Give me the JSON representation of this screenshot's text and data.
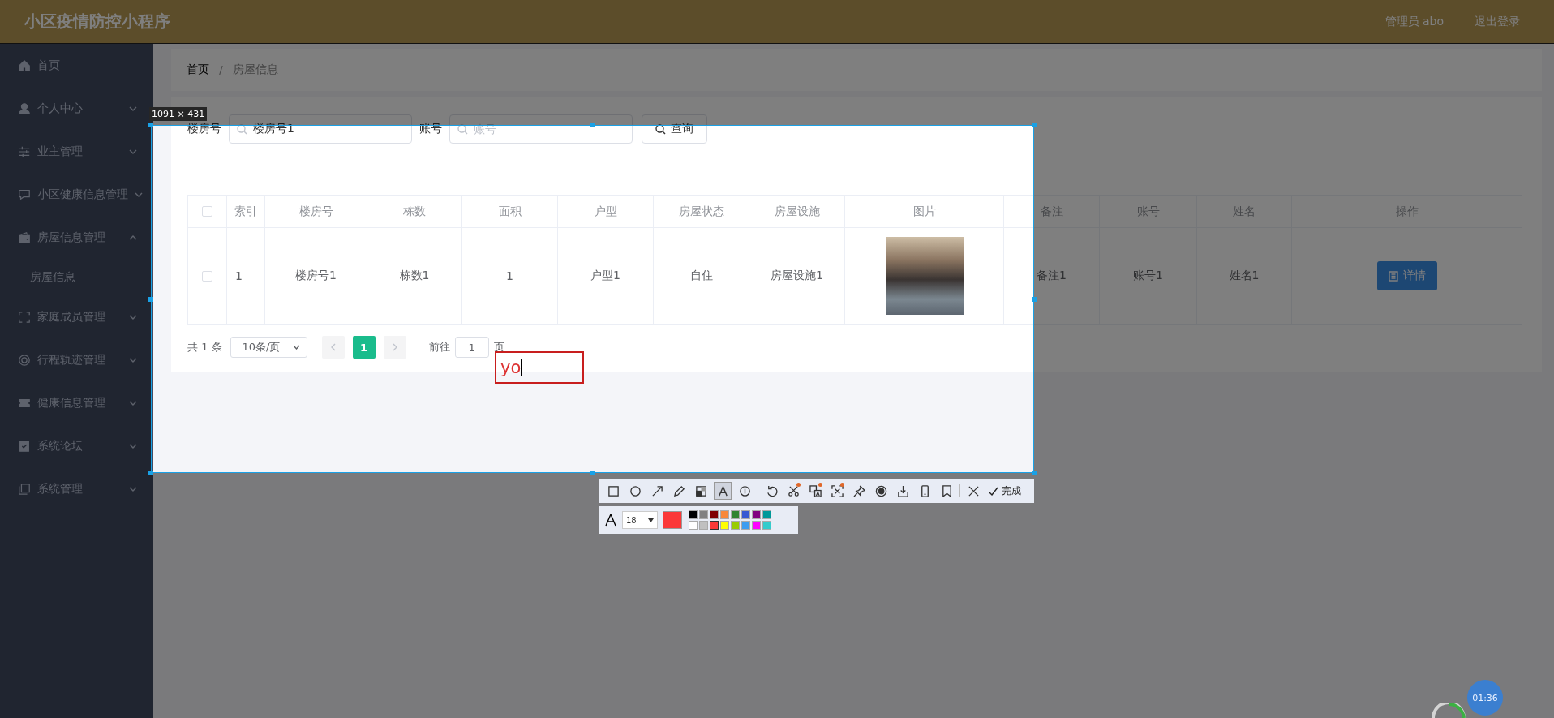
{
  "header": {
    "title": "小区疫情防控小程序",
    "user": "管理员 abo",
    "logout": "退出登录"
  },
  "sidebar": {
    "items": [
      {
        "kind": "link",
        "label": "首页"
      },
      {
        "kind": "menu",
        "label": "个人中心",
        "expanded": false
      },
      {
        "kind": "menu",
        "label": "业主管理",
        "expanded": false
      },
      {
        "kind": "menu",
        "label": "小区健康信息管理",
        "expanded": false
      },
      {
        "kind": "menu",
        "label": "房屋信息管理",
        "expanded": true,
        "children": [
          {
            "label": "房屋信息"
          }
        ]
      },
      {
        "kind": "menu",
        "label": "家庭成员管理",
        "expanded": false
      },
      {
        "kind": "menu",
        "label": "行程轨迹管理",
        "expanded": false
      },
      {
        "kind": "menu",
        "label": "健康信息管理",
        "expanded": false
      },
      {
        "kind": "menu",
        "label": "系统论坛",
        "expanded": false
      },
      {
        "kind": "menu",
        "label": "系统管理",
        "expanded": false
      }
    ]
  },
  "breadcrumb": {
    "items": [
      "首页",
      "房屋信息"
    ],
    "separator": "/"
  },
  "search": {
    "fields": [
      {
        "label": "楼房号",
        "value": "楼房号1"
      },
      {
        "label": "账号",
        "placeholder": "账号"
      }
    ],
    "button": "查询"
  },
  "table": {
    "all_checked": false,
    "columns": [
      {
        "label": "索引",
        "kind": "text"
      },
      {
        "label": "楼房号",
        "kind": "text"
      },
      {
        "label": "栋数",
        "kind": "text"
      },
      {
        "label": "面积",
        "kind": "text"
      },
      {
        "label": "户型",
        "kind": "text"
      },
      {
        "label": "房屋状态",
        "kind": "text"
      },
      {
        "label": "房屋设施",
        "kind": "text"
      },
      {
        "label": "图片",
        "kind": "image"
      },
      {
        "label": "备注",
        "kind": "text"
      },
      {
        "label": "账号",
        "kind": "text"
      },
      {
        "label": "姓名",
        "kind": "text"
      },
      {
        "label": "操作",
        "kind": "action"
      }
    ],
    "rows": [
      {
        "checked": false,
        "cells": [
          "1",
          "楼房号1",
          "栋数1",
          "1",
          "户型1",
          "自住",
          "房屋设施1",
          "",
          "备注1",
          "账号1",
          "姓名1",
          "详情"
        ]
      }
    ]
  },
  "pagination": {
    "total": "共 1 条",
    "page_size": "10条/页",
    "pages": [
      {
        "label": "1",
        "selected": true
      }
    ],
    "goto_label": "前往",
    "goto_value": "1",
    "goto_suffix": "页"
  },
  "capture_tool": {
    "size_label": "1091 × 431",
    "tools": [
      {
        "kind": "rectangle",
        "selected": false,
        "dot": false
      },
      {
        "kind": "circle",
        "selected": false,
        "dot": false
      },
      {
        "kind": "arrow",
        "selected": false,
        "dot": false
      },
      {
        "kind": "pencil",
        "selected": false,
        "dot": false
      },
      {
        "kind": "mosaic",
        "selected": false,
        "dot": false
      },
      {
        "kind": "text",
        "selected": true,
        "dot": false
      },
      {
        "kind": "number",
        "selected": false,
        "dot": false
      },
      {
        "kind": "undo",
        "selected": false,
        "dot": false
      },
      {
        "kind": "scissors",
        "selected": false,
        "dot": true
      },
      {
        "kind": "translate",
        "selected": false,
        "dot": true
      },
      {
        "kind": "recognize",
        "selected": false,
        "dot": true
      },
      {
        "kind": "pin",
        "selected": false,
        "dot": false
      },
      {
        "kind": "record",
        "selected": false,
        "dot": false
      },
      {
        "kind": "download",
        "selected": false,
        "dot": false
      },
      {
        "kind": "phone",
        "selected": false,
        "dot": false
      },
      {
        "kind": "bookmark",
        "selected": false,
        "dot": false
      },
      {
        "kind": "close",
        "selected": false,
        "dot": false
      }
    ],
    "done": "完成",
    "font_size": "18",
    "palette": [
      {
        "color": "#000000"
      },
      {
        "color": "#808080"
      },
      {
        "color": "#800000"
      },
      {
        "color": "#f7883a"
      },
      {
        "color": "#308430"
      },
      {
        "color": "#385ad3"
      },
      {
        "color": "#800080"
      },
      {
        "color": "#009999"
      },
      {
        "color": "#ffffff"
      },
      {
        "color": "#c0c0c0"
      },
      {
        "color": "#fb3838",
        "selected": true
      },
      {
        "color": "#ffff00"
      },
      {
        "color": "#99cc00"
      },
      {
        "color": "#3d9df0"
      },
      {
        "color": "#ff00ff"
      },
      {
        "color": "#33cccc"
      }
    ],
    "text_box": "yo"
  },
  "timer": "01:36"
}
